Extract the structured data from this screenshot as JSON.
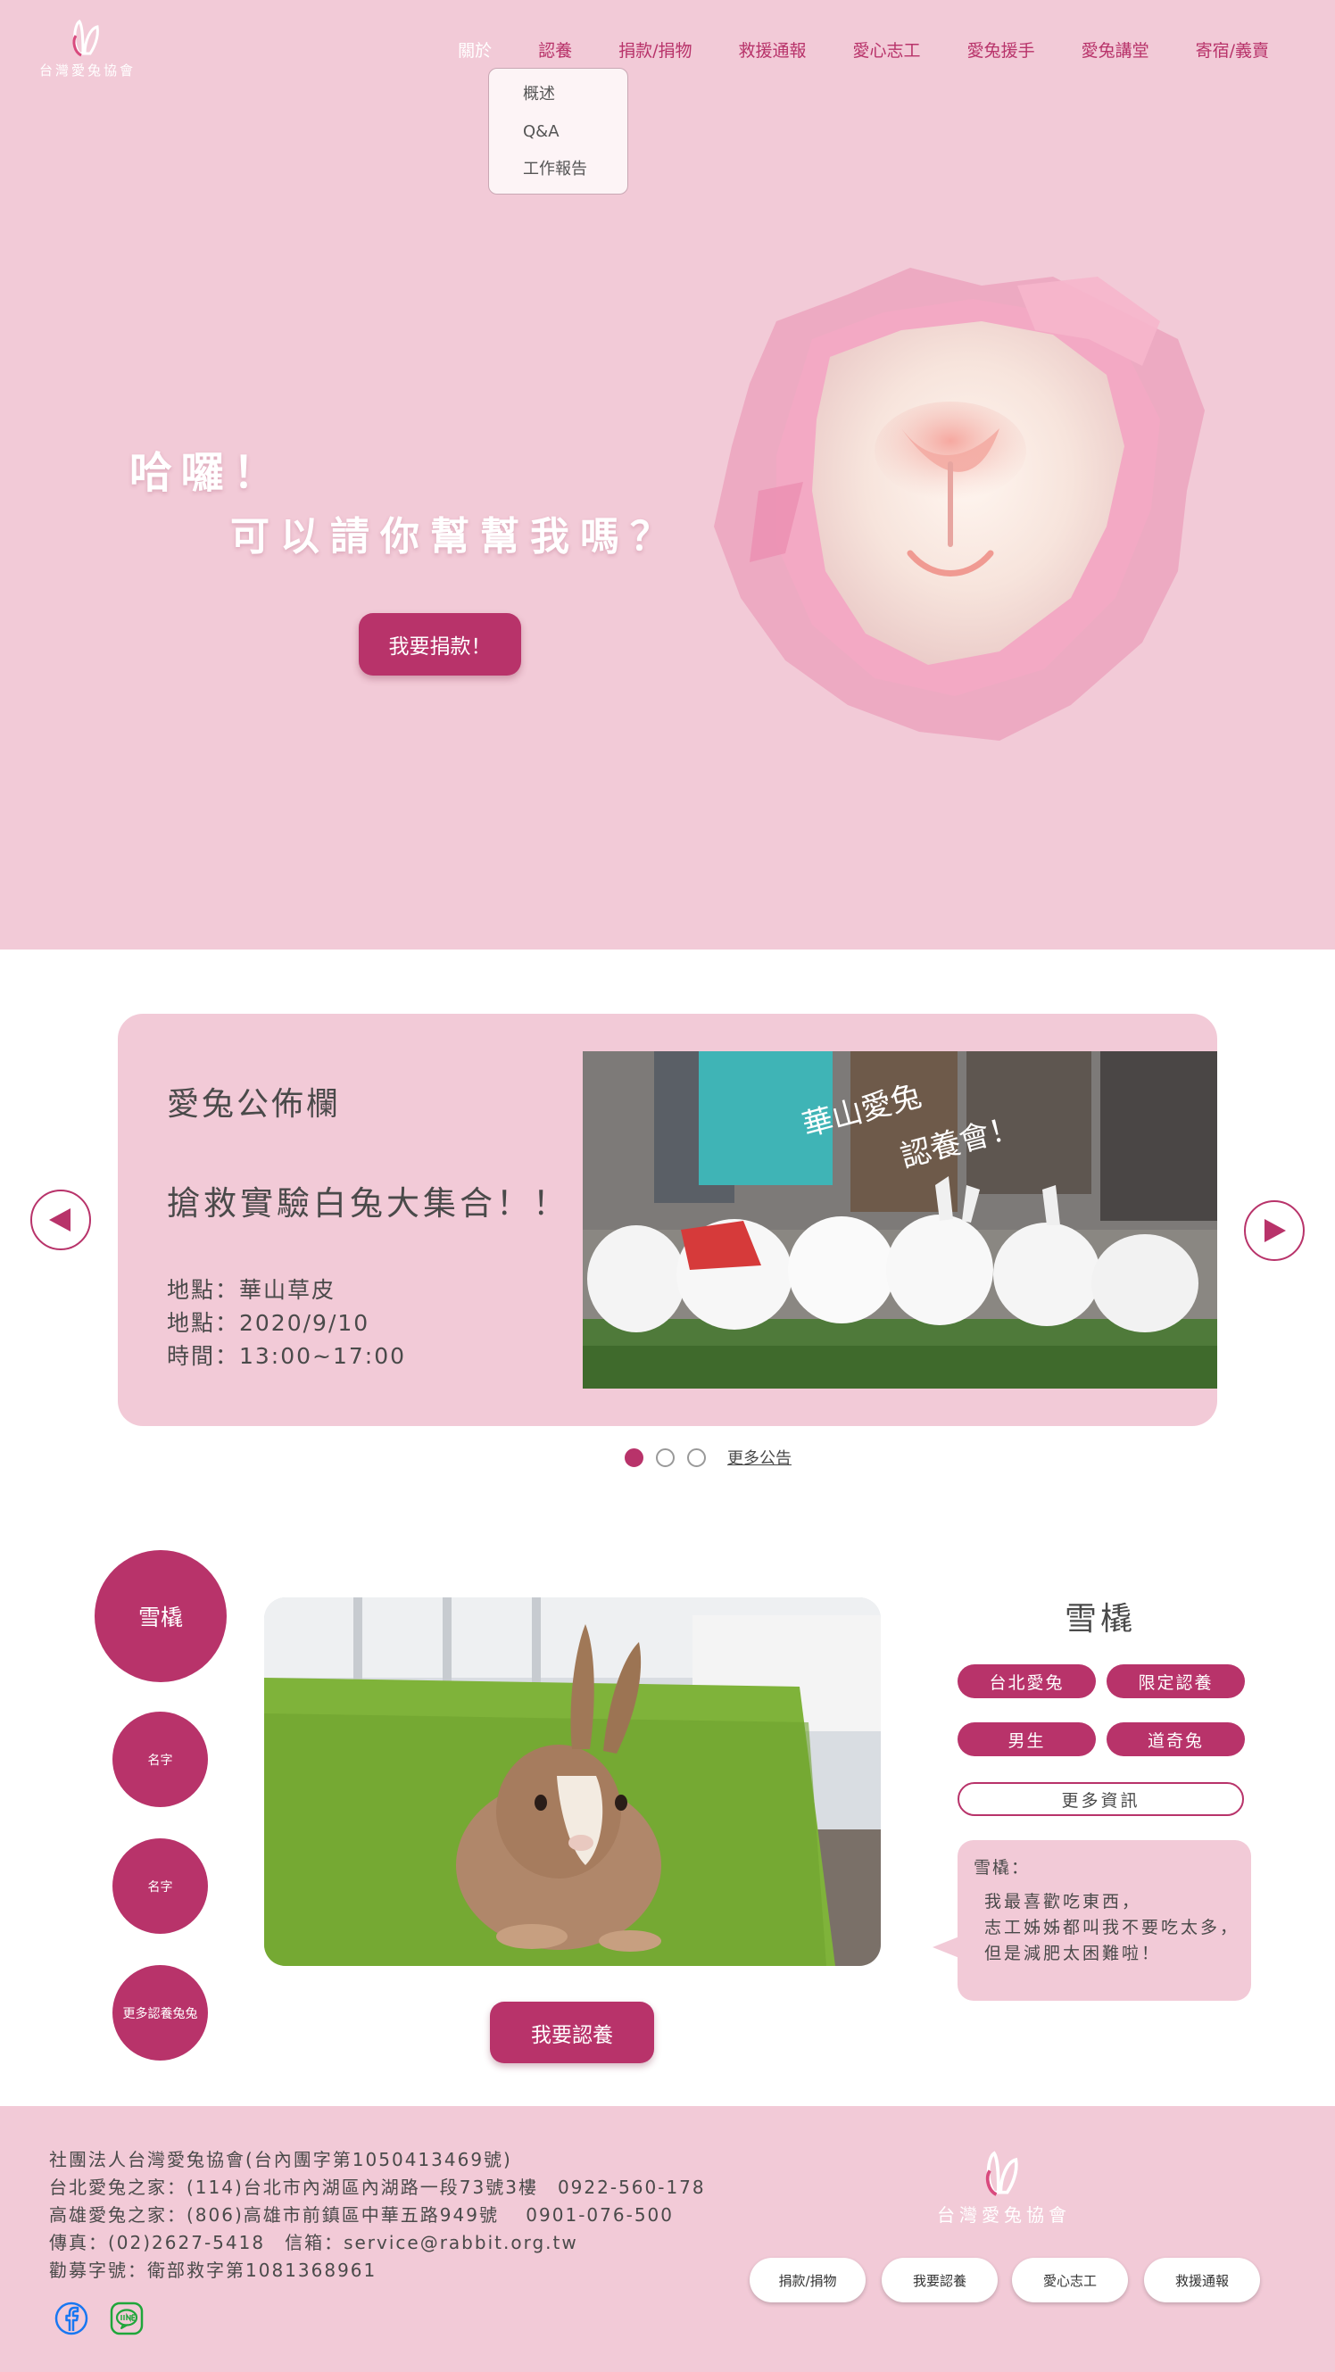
{
  "header": {
    "logo_text": "台灣愛兔協會",
    "nav": [
      {
        "label": "關於",
        "active": true
      },
      {
        "label": "認養"
      },
      {
        "label": "捐款/捐物"
      },
      {
        "label": "救援通報"
      },
      {
        "label": "愛心志工"
      },
      {
        "label": "愛兔援手"
      },
      {
        "label": "愛兔講堂"
      },
      {
        "label": "寄宿/義賣"
      }
    ],
    "dropdown": [
      "概述",
      "Q&A",
      "工作報告"
    ]
  },
  "hero": {
    "line1": "哈囉！",
    "line2": "可以請你幫幫我嗎？",
    "donate_label": "我要捐款！"
  },
  "news": {
    "heading": "愛兔公佈欄",
    "title": "搶救實驗白兔大集合！！",
    "lines": [
      "地點：華山草皮",
      "地點：2020/9/10",
      "時間：13:00~17:00"
    ],
    "photo_caption_1": "華山愛兔",
    "photo_caption_2": "認養會！",
    "more_label": "更多公告",
    "page_count": 3,
    "current_page": 1
  },
  "adoption": {
    "selected_name": "雪橇",
    "circles": [
      "名字",
      "名字",
      "更多認養兔兔"
    ],
    "pet_name": "雪橇",
    "tags": [
      "台北愛兔",
      "限定認養",
      "男生",
      "道奇兔"
    ],
    "more_info_label": "更多資訊",
    "bubble_name": "雪橇：",
    "bubble_lines": [
      "我最喜歡吃東西，",
      "志工姊姊都叫我不要吃太多，",
      "但是減肥太困難啦！"
    ],
    "adopt_label": "我要認養"
  },
  "footer": {
    "lines": [
      "社團法人台灣愛兔協會(台內團字第1050413469號)",
      "台北愛兔之家：(114)台北市內湖區內湖路一段73號3樓　0922-560-178",
      "高雄愛兔之家：(806)高雄市前鎮區中華五路949號　 0901-076-500",
      "傳真：(02)2627-5418　信箱：service@rabbit.org.tw",
      "勸募字號：衛部救字第1081368961"
    ],
    "logo_text": "台灣愛兔協會",
    "buttons": [
      "捐款/捐物",
      "我要認養",
      "愛心志工",
      "救援通報"
    ]
  },
  "colors": {
    "accent": "#b8336a",
    "pink_bg": "#f2cad7",
    "white": "#ffffff",
    "text": "#4a4a4a"
  },
  "icons": [
    "rabbit-logo-icon",
    "arrow-left-icon",
    "arrow-right-icon",
    "facebook-icon",
    "line-icon"
  ]
}
